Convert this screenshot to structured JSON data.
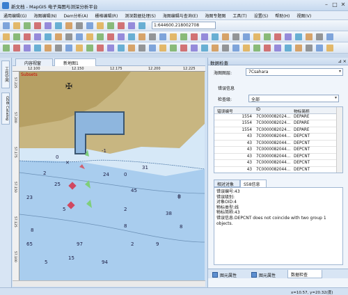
{
  "window": {
    "title": "新文档 - MapGIS 电子海图与测深分析平台"
  },
  "menu": [
    "通用编辑(G)",
    "海图编辑(N)",
    "Dem分析(A)",
    "栅格编辑(R)",
    "测深数据处理(S)",
    "海图编辑与查询(E)",
    "海图专题图",
    "工具(T)",
    "设置(S)",
    "帮助(H)",
    "视图(V)"
  ],
  "toolbar": {
    "coord_value": "1:644600.218002708"
  },
  "left_tabs": [
    "工作空间",
    "GDB Catalog"
  ],
  "doc_tabs": [
    "内容视窗",
    "新地图1"
  ],
  "ruler": {
    "top_ticks": [
      "12.100",
      "12.150",
      "12.175",
      "12.200",
      "12.225"
    ],
    "left_ticks": [
      "57.225",
      "57.200",
      "57.175",
      "57.150",
      "57.125",
      "57.100"
    ]
  },
  "map": {
    "depths": [
      "0",
      "2",
      "-1",
      "0",
      "31",
      "25",
      "24",
      "23",
      "45",
      "5",
      "2",
      "38",
      "8",
      "8",
      "9",
      "97",
      "65",
      "15",
      "2",
      "94",
      "8",
      "5"
    ],
    "corner_label": "Subsets"
  },
  "panel": {
    "title": "数据检查",
    "chart_label": "海图图层:",
    "chart_value": "7Csahara",
    "group_title": "错误信息",
    "level_label": "检查级:",
    "level_value": "全部",
    "columns": [
      "错误编号",
      "ID",
      "物标简称"
    ],
    "rows": [
      [
        "1554",
        "7C0000082024...",
        "DEPARE"
      ],
      [
        "1554",
        "7C0000082024...",
        "DEPARE"
      ],
      [
        "1554",
        "7C0000082024...",
        "DEPARE"
      ],
      [
        "43",
        "7C0000082044...",
        "DEPCNT"
      ],
      [
        "43",
        "7C0000082044...",
        "DEPCNT"
      ],
      [
        "43",
        "7C0000082044...",
        "DEPCNT"
      ],
      [
        "43",
        "7C0000082044...",
        "DEPCNT"
      ],
      [
        "43",
        "7C0000082044...",
        "DEPCNT"
      ],
      [
        "43",
        "7C0000082044...",
        "DEPCNT"
      ]
    ],
    "info_tabs": [
      "相对对象",
      "S58信息"
    ],
    "info_lines": [
      "错误编号:43",
      "错误级别:",
      "对象OID:4",
      "物标类型:线",
      "物标简称:43",
      "错误信息:DEPCNT does not coincide with two group 1",
      "objects."
    ],
    "bottom_tabs": [
      "图元属性",
      "图元属性",
      "数据检查"
    ]
  },
  "status": {
    "coords": "x=10.57, y=20.32(度)"
  }
}
